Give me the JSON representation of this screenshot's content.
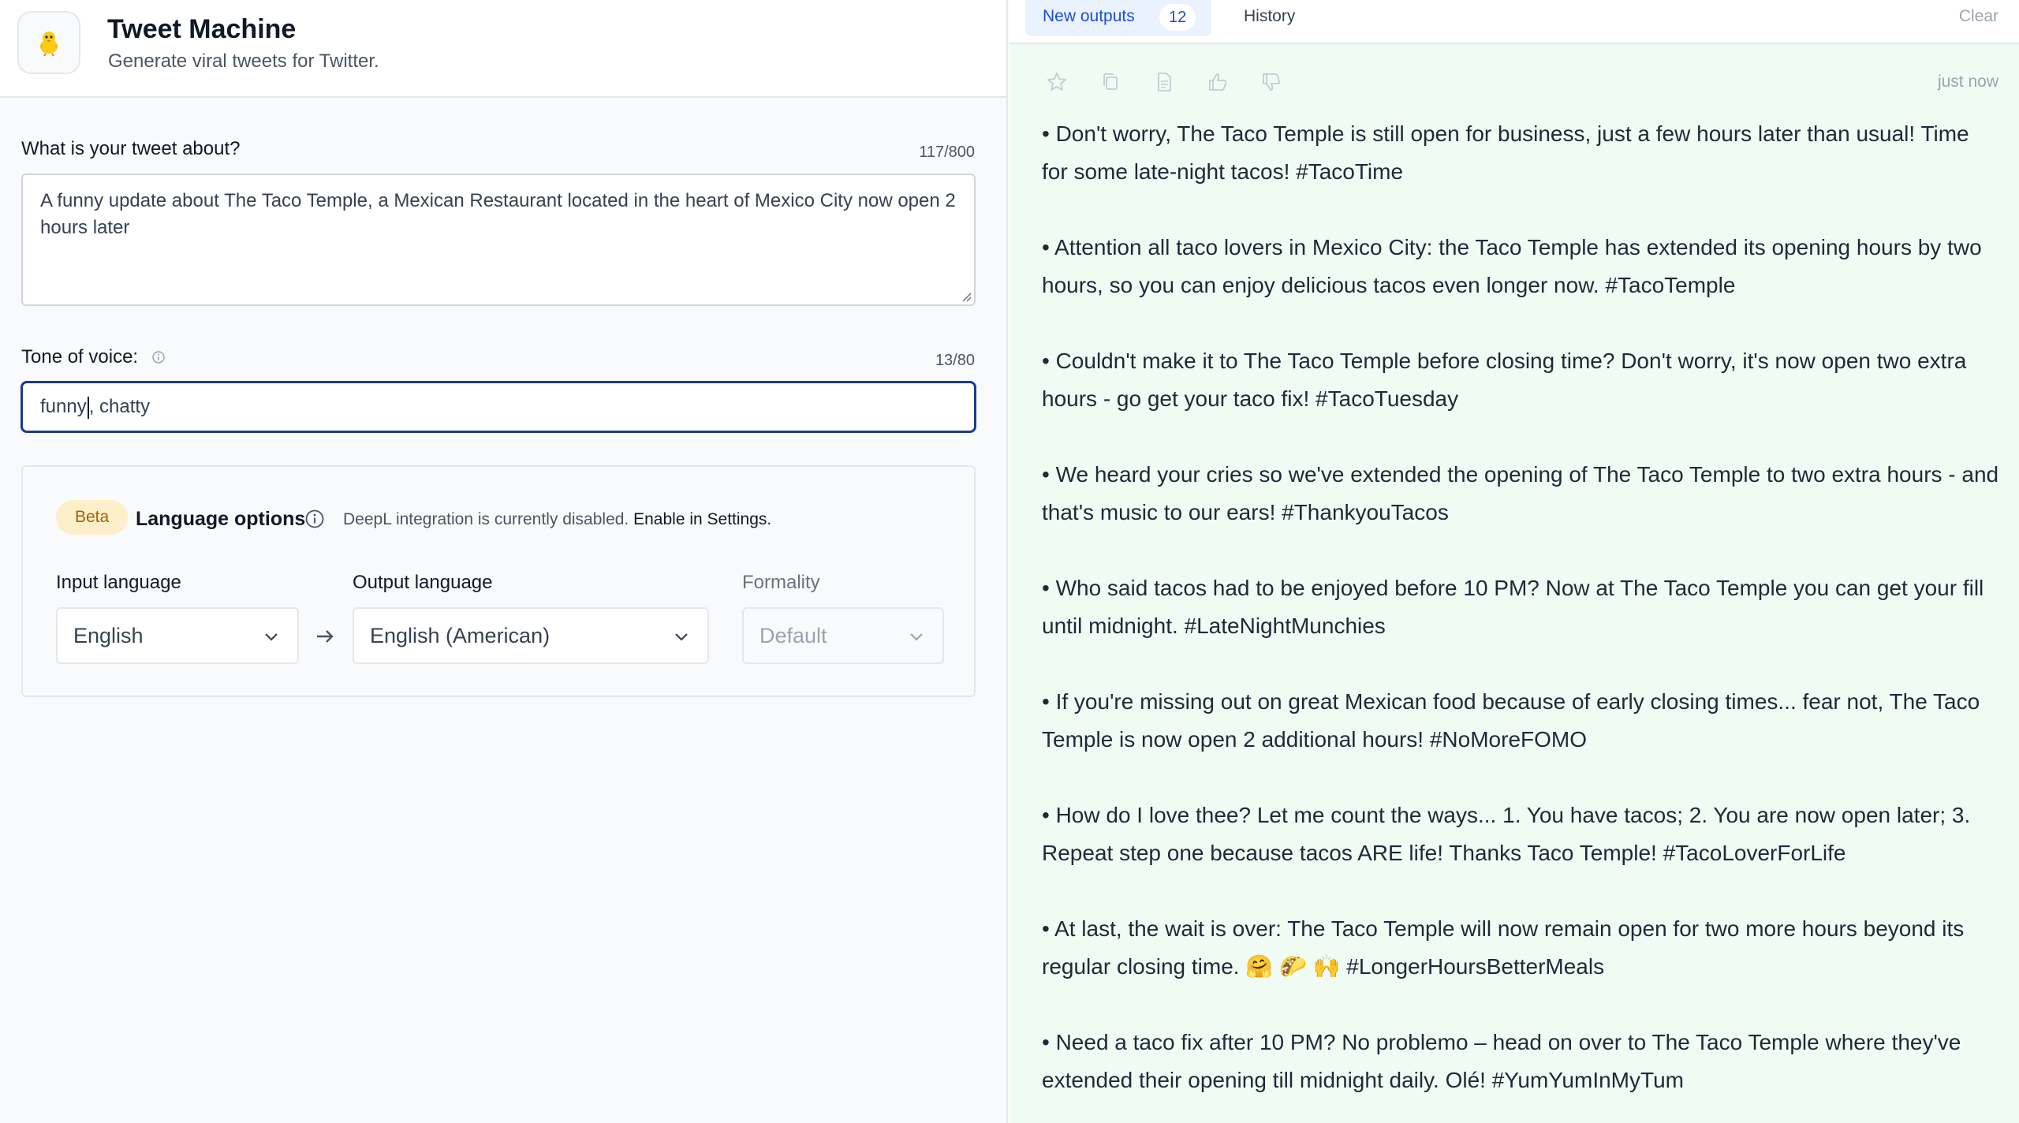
{
  "app": {
    "icon": "chick-icon",
    "title": "Tweet Machine",
    "subtitle": "Generate viral tweets for Twitter."
  },
  "form": {
    "topic": {
      "label": "What is your tweet about?",
      "counter": "117/800",
      "value": "A funny update about The Taco Temple, a Mexican Restaurant located in the heart of Mexico City now open 2 hours later"
    },
    "tone": {
      "label": "Tone of voice:",
      "counter": "13/80",
      "value_before_caret": "funny",
      "value_after_caret": ", chatty"
    },
    "language": {
      "badge": "Beta",
      "title": "Language options",
      "note": "DeepL integration is currently disabled.",
      "note_link": "Enable in Settings.",
      "input_label": "Input language",
      "input_value": "English",
      "output_label": "Output language",
      "output_value": "English (American)",
      "formality_label": "Formality",
      "formality_value": "Default"
    }
  },
  "results": {
    "tabs": {
      "new_outputs": "New outputs",
      "count": "12",
      "history": "History",
      "clear": "Clear"
    },
    "toolbar_icons": [
      "star-icon",
      "copy-icon",
      "document-icon",
      "thumbs-up-icon",
      "thumbs-down-icon"
    ],
    "timestamp": "just now",
    "tweets": [
      "• Don't worry, The Taco Temple is still open for business, just a few hours later than usual! Time for some late-night tacos! #TacoTime",
      "• Attention all taco lovers in Mexico City: the Taco Temple has extended its opening hours by two hours, so you can enjoy delicious tacos even longer now. #TacoTemple",
      "• Couldn't make it to The Taco Temple before closing time? Don't worry, it's now open two extra hours - go get your taco fix! #TacoTuesday",
      "• We heard your cries so we've extended the opening of The Taco Temple to two extra hours - and that's music to our ears! #ThankyouTacos",
      "• Who said tacos had to be enjoyed before 10 PM? Now at The Taco Temple you can get your fill until midnight. #LateNightMunchies",
      "• If you're missing out on great Mexican food because of early closing times... fear not, The Taco Temple is now open 2 additional hours! #NoMoreFOMO",
      "• How do I love thee? Let me count the ways... 1. You have tacos; 2. You are now open later; 3. Repeat step one because tacos ARE life! Thanks Taco Temple! #TacoLoverForLife",
      "• At last, the wait is over: The Taco Temple will now remain open for two more hours beyond its regular closing time. 🤗 🌮 🙌 #LongerHoursBetterMeals",
      "• Need a taco fix after 10 PM? No problemo – head on over to The Taco Temple where they've extended their opening till midnight daily. Olé! #YumYumInMyTum"
    ]
  },
  "colors": {
    "accent": "#1e3a8a",
    "tab_blue": "#1d4ed8",
    "results_bg": "#f0fbf3",
    "beta_bg": "#fdefc7",
    "beta_text": "#a16207"
  }
}
